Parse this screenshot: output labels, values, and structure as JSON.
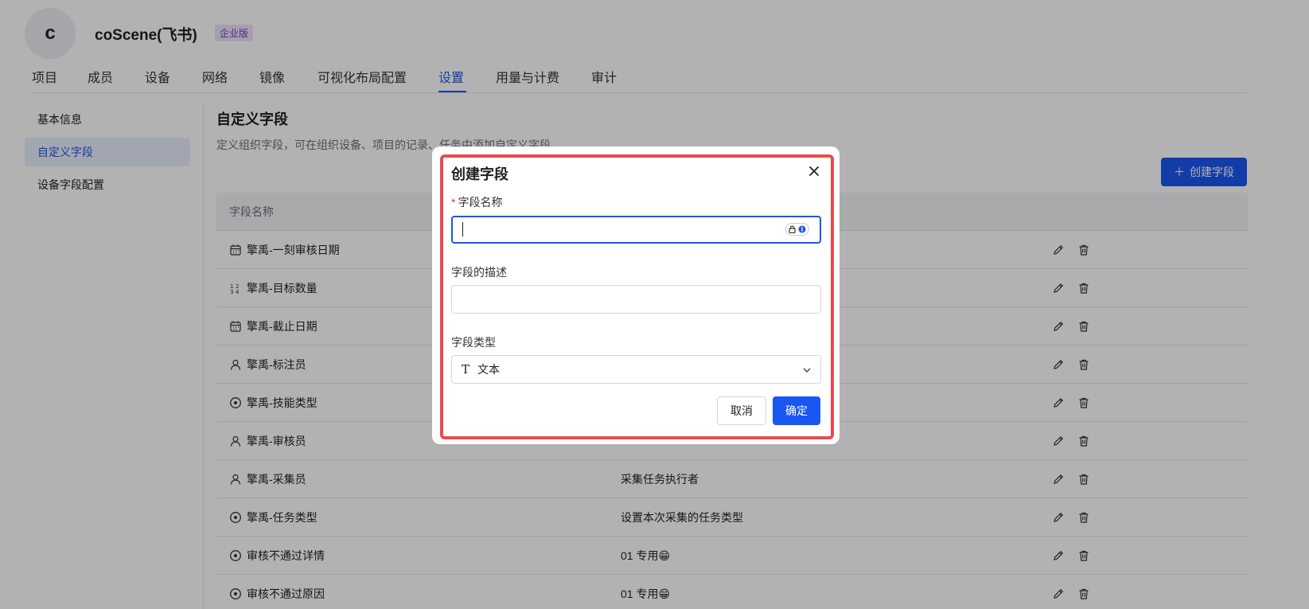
{
  "header": {
    "avatar_letter": "c",
    "org_name": "coScene(飞书)",
    "badge": "企业版"
  },
  "tabs": [
    {
      "label": "项目"
    },
    {
      "label": "成员"
    },
    {
      "label": "设备"
    },
    {
      "label": "网络"
    },
    {
      "label": "镜像"
    },
    {
      "label": "可视化布局配置"
    },
    {
      "label": "设置",
      "active": true
    },
    {
      "label": "用量与计费"
    },
    {
      "label": "审计"
    }
  ],
  "sidebar": {
    "items": [
      {
        "label": "基本信息"
      },
      {
        "label": "自定义字段",
        "active": true
      },
      {
        "label": "设备字段配置"
      }
    ]
  },
  "main": {
    "title": "自定义字段",
    "description": "定义组织字段，可在组织设备、项目的记录、任务中添加自定义字段",
    "create_button": "创建字段",
    "table": {
      "header_name": "字段名称",
      "rows": [
        {
          "icon": "calendar-icon",
          "name": "擎禹-一刻审核日期",
          "desc": ""
        },
        {
          "icon": "number-icon",
          "name": "擎禹-目标数量",
          "desc": ""
        },
        {
          "icon": "calendar-icon",
          "name": "擎禹-截止日期",
          "desc": ""
        },
        {
          "icon": "user-icon",
          "name": "擎禹-标注员",
          "desc": ""
        },
        {
          "icon": "select-icon",
          "name": "擎禹-技能类型",
          "desc": ""
        },
        {
          "icon": "user-icon",
          "name": "擎禹-审核员",
          "desc": ""
        },
        {
          "icon": "user-icon",
          "name": "擎禹-采集员",
          "desc": "采集任务执行者"
        },
        {
          "icon": "select-icon",
          "name": "擎禹-任务类型",
          "desc": "设置本次采集的任务类型"
        },
        {
          "icon": "select-icon",
          "name": "审核不通过详情",
          "desc": "01 专用😁"
        },
        {
          "icon": "select-icon",
          "name": "审核不通过原因",
          "desc": "01 专用😁"
        }
      ]
    }
  },
  "modal": {
    "title": "创建字段",
    "name_label": "字段名称",
    "name_value": "",
    "desc_label": "字段的描述",
    "desc_value": "",
    "type_label": "字段类型",
    "type_value": "文本",
    "type_icon": "text-type-icon",
    "cancel": "取消",
    "confirm": "确定"
  },
  "colors": {
    "accent": "#1a56f0",
    "highlight": "#e74c4c",
    "badge_bg": "#ede2fb",
    "badge_text": "#7a3fc2"
  }
}
